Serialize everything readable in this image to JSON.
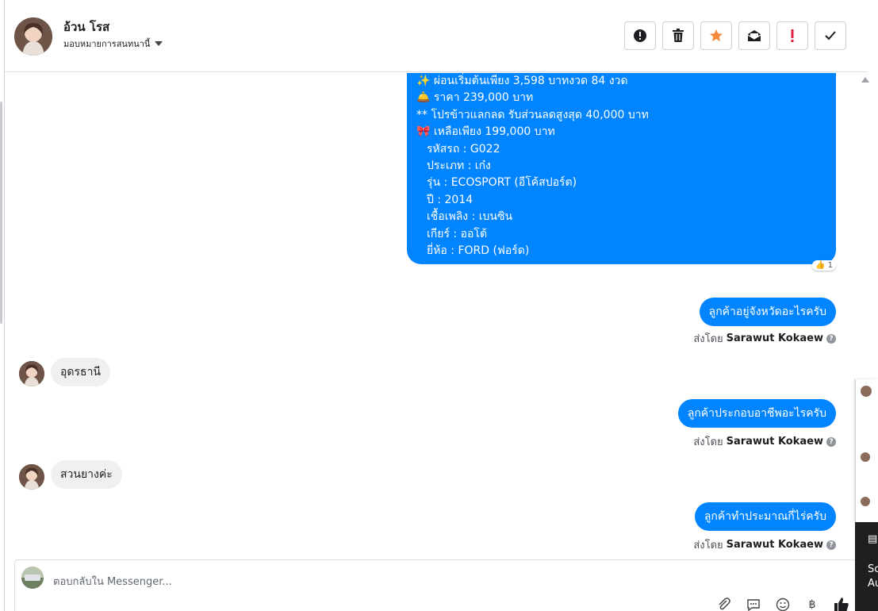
{
  "header": {
    "name": "อ้วน โรส",
    "assign_label": "มอบหมายการสนทนานี้",
    "actions": [
      {
        "id": "report",
        "icon": "alert-circle-icon"
      },
      {
        "id": "delete",
        "icon": "trash-icon"
      },
      {
        "id": "star",
        "icon": "star-icon",
        "color": "#f5883a"
      },
      {
        "id": "mark-unread",
        "icon": "envelope-icon"
      },
      {
        "id": "important",
        "icon": "exclamation-icon",
        "color": "#e41e3f"
      },
      {
        "id": "done",
        "icon": "check-icon"
      }
    ]
  },
  "messages": {
    "listing": {
      "lines": [
        "✨ ผ่อนเริ่มต้นเพียง 3,598 บาทงวด 84 งวด",
        "🛎️  ราคา 239,000 บาท",
        "** โปรข้าวแลกลด รับส่วนลดสูงสุด 40,000 บาท",
        "🎀 เหลือเพียง 199,000 บาท",
        "   รหัสรถ : G022",
        "  ประเภท : เก๋ง",
        "  รุ่น : ECOSPORT (อีโค้สปอร์ต)",
        "  ปี : 2014",
        "  เชื้อเพลิง : เบนซิน",
        "  เกียร์ : ออโต้",
        "  ยี่ห้อ : FORD (ฟอร์ด)"
      ],
      "reaction_emoji": "👍",
      "reaction_count": "1"
    },
    "out1": "ลูกค้าอยู่จังหวัดอะไรครับ",
    "in1": "อุดรธานี",
    "out2": "ลูกค้าประกอบอาชีพอะไรครับ",
    "in2": "สวนยางค่ะ",
    "out3": "ลูกค้าทำประมาณกี่ไร่ครับ",
    "sent_by_label": "ส่งโดย",
    "sender": "Sarawut Kokaew"
  },
  "composer": {
    "placeholder": "ตอบกลับใน Messenger..."
  },
  "side": {
    "dark_top": "Sc",
    "dark_bottom": "Au"
  },
  "colors": {
    "outgoing": "#0084ff",
    "incoming": "#f1f0f0",
    "star": "#f5883a",
    "important": "#e41e3f"
  }
}
